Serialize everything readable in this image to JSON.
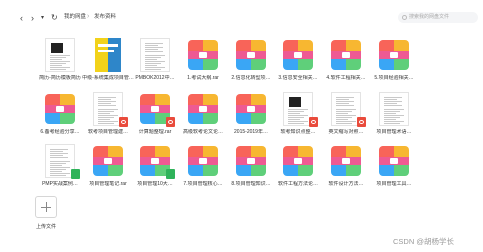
{
  "nav": {
    "back_icon": "chevron-left-icon",
    "forward_icon": "chevron-right-icon",
    "dropdown_icon": "chevron-down-icon",
    "refresh_icon": "refresh-icon"
  },
  "breadcrumb": [
    "我的网盘",
    "发布资料"
  ],
  "search": {
    "placeholder": "搜索我的网盘文件"
  },
  "files": [
    {
      "name": "简历-简历模板简历",
      "kind": "doc-photo"
    },
    {
      "name": "中级-系统集成项目管…",
      "kind": "cover-book"
    },
    {
      "name": "PMBOK2012中…",
      "kind": "doc-text"
    },
    {
      "name": "1.考试大纲.rar",
      "kind": "zip"
    },
    {
      "name": "2.信息化转型项…",
      "kind": "zip"
    },
    {
      "name": "3.信息安全相关…",
      "kind": "zip"
    },
    {
      "name": "4.软件工程相关…",
      "kind": "zip"
    },
    {
      "name": "5.项目经验相关…",
      "kind": "zip"
    },
    {
      "name": "6.备考经验分享…",
      "kind": "zip"
    },
    {
      "name": "软考项目管理建…",
      "kind": "doc-pdf"
    },
    {
      "name": "计算题整理.rar",
      "kind": "zip-pdf"
    },
    {
      "name": "高级软考论文论…",
      "kind": "zip"
    },
    {
      "name": "2015-2019年…",
      "kind": "zip"
    },
    {
      "name": "软考知识点整…",
      "kind": "doc-pdf-img"
    },
    {
      "name": "英文缩写对照…",
      "kind": "doc-pdf"
    },
    {
      "name": "项目管理术语…",
      "kind": "doc-plain"
    },
    {
      "name": "PMP实战案例…",
      "kind": "doc-xls"
    },
    {
      "name": "项目管理笔记.rar",
      "kind": "zip"
    },
    {
      "name": "项目管理10大…",
      "kind": "zip-xls"
    },
    {
      "name": "7.项目管理核心…",
      "kind": "zip"
    },
    {
      "name": "8.项目管理知识…",
      "kind": "zip"
    },
    {
      "name": "软件工程方法论…",
      "kind": "zip"
    },
    {
      "name": "软件设计方法…",
      "kind": "zip"
    },
    {
      "name": "项目管理工具…",
      "kind": "zip"
    }
  ],
  "upload": {
    "label": "上传文件"
  },
  "watermark": "CSDN @胡杨学长"
}
